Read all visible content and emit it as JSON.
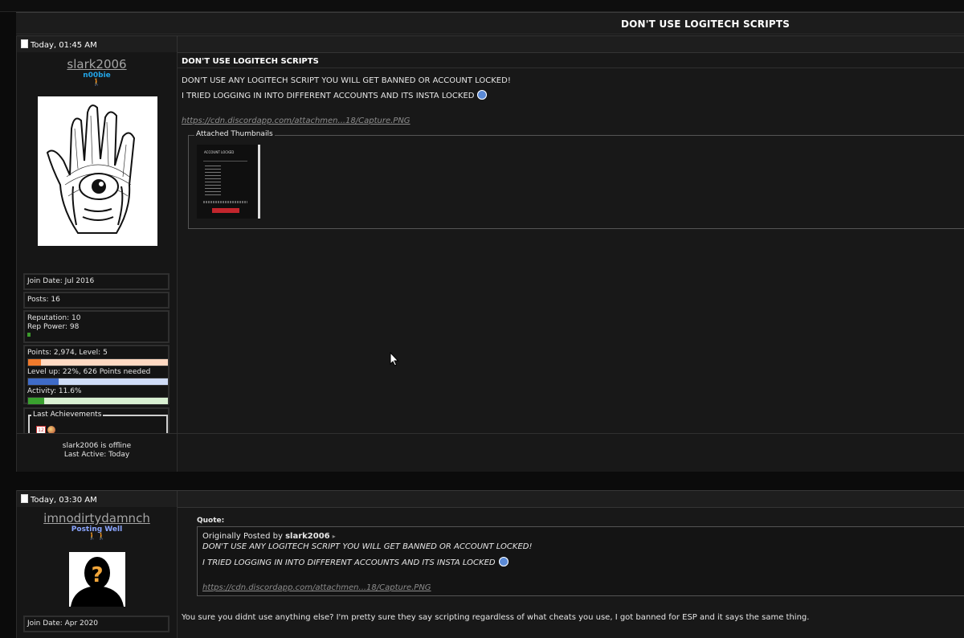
{
  "thread": {
    "title": "DON'T USE LOGITECH SCRIPTS"
  },
  "post1": {
    "date": "Today, 01:45 AM",
    "username": "slark2006",
    "user_title": "n00bie",
    "title_color": "#22a4e6",
    "join_date": "Join Date: Jul 2016",
    "posts": "Posts: 16",
    "reputation": "Reputation: 10",
    "rep_power": "Rep Power: 98",
    "points_level": "Points: 2,974, Level: 5",
    "points_fraction": 0.09,
    "level_up": "Level up: 22%, 626 Points needed",
    "level_up_fraction": 0.22,
    "activity": "Activity: 11.6%",
    "activity_fraction": 0.116,
    "achievements_legend": "Last Achievements",
    "online_status": "slark2006 is offline",
    "last_active": "Last Active: Today",
    "subject": "DON'T USE LOGITECH SCRIPTS",
    "line1": "DON'T USE ANY LOGITECH SCRIPT YOU WILL GET BANNED OR ACCOUNT LOCKED!",
    "line2": "I TRIED LOGGING IN INTO DIFFERENT ACCOUNTS AND ITS INSTA LOCKED",
    "link": "https://cdn.discordapp.com/attachmen...18/Capture.PNG",
    "attach_legend": "Attached Thumbnails",
    "thumb_title": "ACCOUNT LOCKED"
  },
  "post2": {
    "date": "Today, 03:30 AM",
    "username": "imnodirtydamnch",
    "user_title": "Posting Well",
    "title_color": "#8ba6ff",
    "join_date": "Join Date: Apr 2020",
    "quote_label": "Quote:",
    "quote_prefix": "Originally Posted by",
    "quote_author": "slark2006",
    "quote_line1": "DON'T USE ANY LOGITECH SCRIPT YOU WILL GET BANNED OR ACCOUNT LOCKED!",
    "quote_line2": "I TRIED LOGGING IN INTO DIFFERENT ACCOUNTS AND ITS INSTA LOCKED",
    "quote_link": "https://cdn.discordapp.com/attachmen...18/Capture.PNG",
    "reply": "You sure you didnt use anything else? I'm pretty sure they say scripting regardless of what cheats you use, I got banned for ESP and it says the same thing."
  }
}
